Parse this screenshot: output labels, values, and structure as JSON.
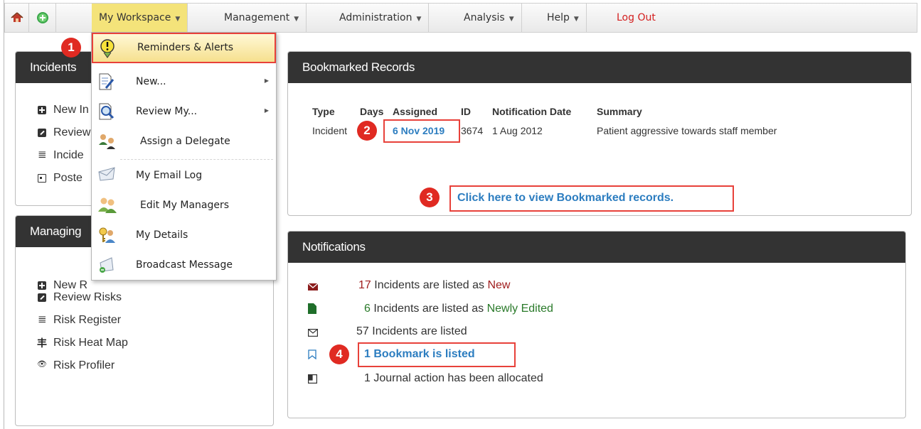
{
  "menubar": {
    "home_icon": "home-icon",
    "add_icon": "add-circle-icon",
    "items": [
      {
        "label": "My Workspace"
      },
      {
        "label": "Management"
      },
      {
        "label": "Administration"
      },
      {
        "label": "Analysis"
      },
      {
        "label": "Help"
      }
    ],
    "logout_label": "Log Out"
  },
  "dropdown": {
    "items": [
      {
        "label": "Reminders & Alerts",
        "icon": "alert-icon"
      },
      {
        "label": "New...",
        "icon": "document-edit-icon"
      },
      {
        "label": "Review My...",
        "icon": "document-search-icon"
      },
      {
        "label": "Assign a Delegate",
        "icon": "delegate-icon"
      },
      {
        "label": "My Email Log",
        "icon": "email-icon"
      },
      {
        "label": "Edit My Managers",
        "icon": "managers-icon"
      },
      {
        "label": "My Details",
        "icon": "user-key-icon"
      },
      {
        "label": "Broadcast Message",
        "icon": "broadcast-icon"
      }
    ]
  },
  "incidents_panel": {
    "title": "Incidents",
    "items": [
      {
        "label": "New In"
      },
      {
        "label": "Review"
      },
      {
        "label": "Incide"
      },
      {
        "label": "Poste"
      }
    ]
  },
  "managing_panel": {
    "title": "Managing",
    "items": [
      {
        "label": "New R"
      },
      {
        "label": "Review Risks"
      },
      {
        "label": "Risk Register"
      },
      {
        "label": "Risk Heat Map"
      },
      {
        "label": "Risk Profiler"
      }
    ]
  },
  "bookmarked_panel": {
    "title": "Bookmarked Records",
    "columns": [
      "Type",
      "Days",
      "Assigned",
      "ID",
      "Notification Date",
      "Summary"
    ],
    "row": {
      "type": "Incident",
      "assigned": "6 Nov 2019",
      "id": "3674",
      "notification_date": "1 Aug 2012",
      "summary": "Patient aggressive towards staff member"
    },
    "view_link": "Click here to view Bookmarked records."
  },
  "notifications_panel": {
    "title": "Notifications",
    "items": [
      {
        "count": "17",
        "text": "Incidents are listed as",
        "status": "New",
        "color": "#a01e1e"
      },
      {
        "count": "6",
        "text": "Incidents are listed as",
        "status": "Newly Edited",
        "color": "#2a7a2a"
      },
      {
        "text": "57 Incidents are listed"
      },
      {
        "text": "1 Bookmark  is listed"
      },
      {
        "text": "1 Journal action has been allocated"
      }
    ]
  },
  "callouts": [
    "1",
    "2",
    "3",
    "4"
  ],
  "colors": {
    "accent_link": "#2c7dc0",
    "callout_red": "#e02a22",
    "menu_selected": "#f4e37a",
    "panel_header": "#333333"
  }
}
